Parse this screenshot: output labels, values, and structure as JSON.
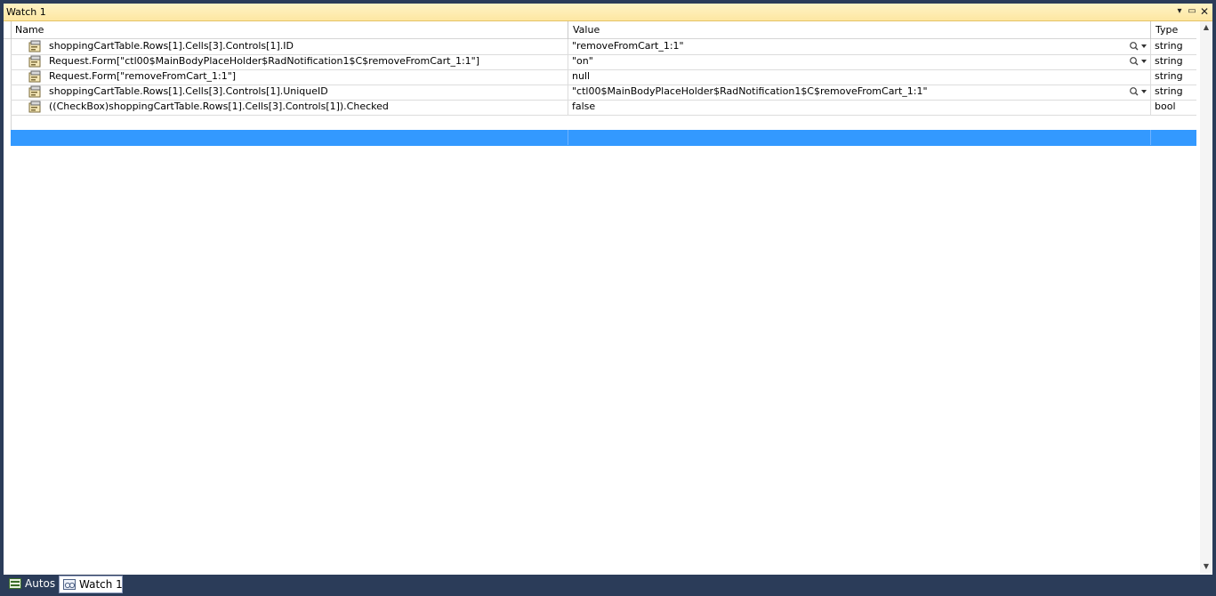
{
  "window": {
    "title": "Watch 1"
  },
  "columns": {
    "name": "Name",
    "value": "Value",
    "type": "Type"
  },
  "rows": [
    {
      "name": "shoppingCartTable.Rows[1].Cells[3].Controls[1].ID",
      "value": "\"removeFromCart_1:1\"",
      "type": "string",
      "visualizer": true
    },
    {
      "name": "Request.Form[\"ctl00$MainBodyPlaceHolder$RadNotification1$C$removeFromCart_1:1\"]",
      "value": "\"on\"",
      "type": "string",
      "visualizer": true
    },
    {
      "name": "Request.Form[\"removeFromCart_1:1\"]",
      "value": "null",
      "type": "string",
      "visualizer": false
    },
    {
      "name": "shoppingCartTable.Rows[1].Cells[3].Controls[1].UniqueID",
      "value": "\"ctl00$MainBodyPlaceHolder$RadNotification1$C$removeFromCart_1:1\"",
      "type": "string",
      "visualizer": true
    },
    {
      "name": "((CheckBox)shoppingCartTable.Rows[1].Cells[3].Controls[1]).Checked",
      "value": "false",
      "type": "bool",
      "visualizer": false
    }
  ],
  "tabs": [
    {
      "label": "Autos",
      "active": false
    },
    {
      "label": "Watch 1",
      "active": true
    }
  ],
  "colors": {
    "selection": "#3399ff",
    "background": "#2b3c59",
    "titlebar": "#fde7a2"
  }
}
